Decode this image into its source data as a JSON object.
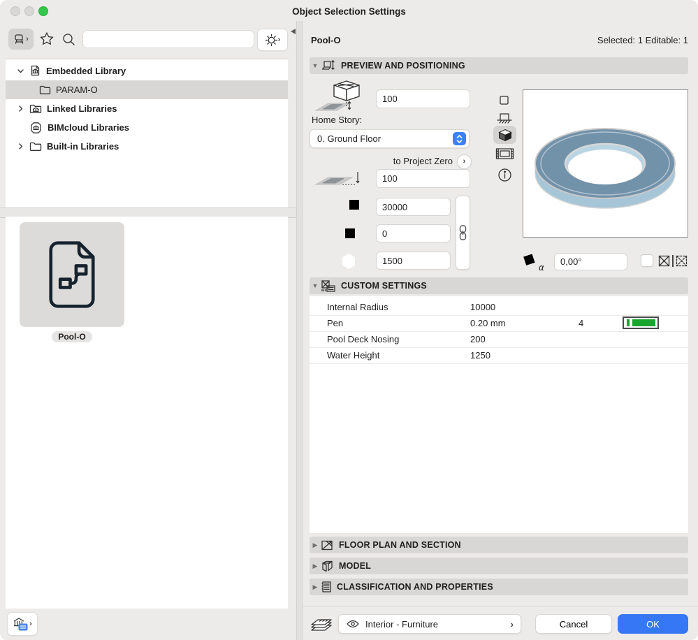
{
  "title_bar": {
    "title": "Object Selection Settings"
  },
  "left_panel": {
    "search": {
      "placeholder": ""
    },
    "tree": [
      {
        "label": "Embedded Library",
        "icon": "embedded-library-icon",
        "expanded": true
      },
      {
        "label": "PARAM-O",
        "icon": "folder-icon",
        "selected": true
      },
      {
        "label": "Linked Libraries",
        "icon": "linked-library-icon",
        "expanded": false
      },
      {
        "label": "BIMcloud Libraries",
        "icon": "bimcloud-library-icon"
      },
      {
        "label": "Built-in Libraries",
        "icon": "builtin-folder-icon",
        "expanded": false
      }
    ],
    "thumbnail": {
      "label": "Pool-O"
    }
  },
  "header": {
    "object_name": "Pool-O",
    "selection_status": "Selected: 1 Editable: 1"
  },
  "sections": {
    "preview_positioning": "PREVIEW AND POSITIONING",
    "custom_settings": "CUSTOM SETTINGS",
    "floor_plan_section": "FLOOR PLAN AND SECTION",
    "model": "MODEL",
    "classification_properties": "CLASSIFICATION AND PROPERTIES"
  },
  "positioning": {
    "height_above_story": "100",
    "home_story_label": "Home Story:",
    "home_story_value": "0. Ground Floor",
    "reference_label": "to Project Zero",
    "elevation_value": "100",
    "width_value": "30000",
    "depth_value": "0",
    "height_value": "1500",
    "rotation_angle": "0,00°"
  },
  "custom_settings": {
    "rows": [
      {
        "name": "Internal Radius",
        "value": "10000"
      },
      {
        "name": "Pen",
        "value": "0.20 mm",
        "pen_number": "4"
      },
      {
        "name": "Pool Deck Nosing",
        "value": "200"
      },
      {
        "name": "Water Height",
        "value": "1250"
      }
    ]
  },
  "footer": {
    "layer_value": "Interior - Furniture",
    "cancel_label": "Cancel",
    "ok_label": "OK"
  },
  "colors": {
    "accent_blue": "#3677f6",
    "pen_green": "#17a52e",
    "ring_top": "#7292aa",
    "ring_inner_wall": "#b9d4e2",
    "ring_outer_wall": "#a6c6d8",
    "section_bar": "#d9d7d5",
    "window_bg": "#ecebe9"
  }
}
